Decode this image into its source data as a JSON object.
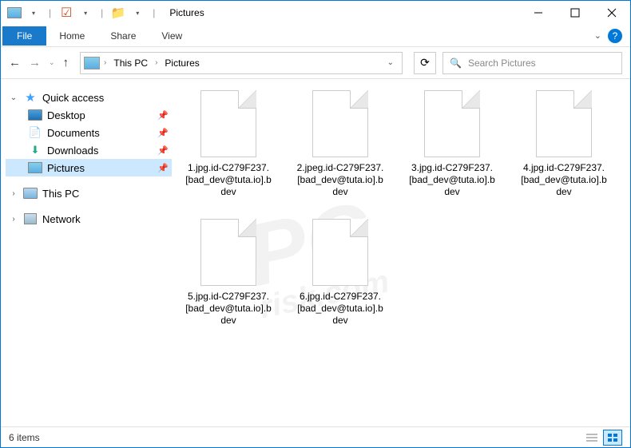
{
  "window": {
    "title": "Pictures"
  },
  "ribbon": {
    "file": "File",
    "tabs": [
      "Home",
      "Share",
      "View"
    ]
  },
  "address": {
    "segments": [
      "This PC",
      "Pictures"
    ]
  },
  "search": {
    "placeholder": "Search Pictures"
  },
  "sidebar": {
    "quick_access": "Quick access",
    "items": [
      {
        "label": "Desktop"
      },
      {
        "label": "Documents"
      },
      {
        "label": "Downloads"
      },
      {
        "label": "Pictures"
      }
    ],
    "this_pc": "This PC",
    "network": "Network"
  },
  "files": [
    {
      "name": "1.jpg.id-C279F237.[bad_dev@tuta.io].bdev"
    },
    {
      "name": "2.jpeg.id-C279F237.[bad_dev@tuta.io].bdev"
    },
    {
      "name": "3.jpg.id-C279F237.[bad_dev@tuta.io].bdev"
    },
    {
      "name": "4.jpg.id-C279F237.[bad_dev@tuta.io].bdev"
    },
    {
      "name": "5.jpg.id-C279F237.[bad_dev@tuta.io].bdev"
    },
    {
      "name": "6.jpg.id-C279F237.[bad_dev@tuta.io].bdev"
    }
  ],
  "status": {
    "count": "6 items"
  }
}
